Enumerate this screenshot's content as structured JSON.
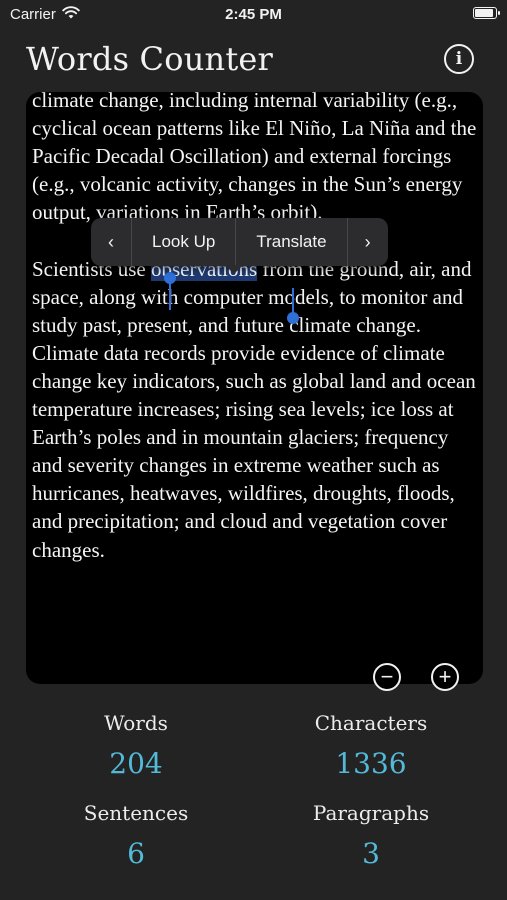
{
  "status_bar": {
    "carrier": "Carrier",
    "time": "2:45 PM",
    "battery_level": 0.9
  },
  "app": {
    "title": "Words Counter",
    "info_icon": "i"
  },
  "editor": {
    "text_before_selection": "climate change, including internal variability (e.g., cyclical ocean patterns like El Niño, La Niña and the Pacific Decadal Oscillation) and external forcings (e.g., volcanic activity, changes in the Sun’s energy output, variations in Earth’s orbit).\n\nScientists use ",
    "selected_text": "observations",
    "text_after_selection": " from the ground, air, and space, along with computer models, to monitor and study past, present, and future climate change. Climate data records provide evidence of climate change key indicators, such as global land and ocean temperature increases; rising sea levels; ice loss at Earth’s poles and in mountain glaciers; frequency and severity changes in extreme weather such as hurricanes, heatwaves, wildfires, droughts, floods, and precipitation; and cloud and vegetation cover changes."
  },
  "context_menu": {
    "prev_icon": "‹",
    "items": [
      "Look Up",
      "Translate"
    ],
    "next_icon": "›"
  },
  "zoom": {
    "out_symbol": "−",
    "in_symbol": "+"
  },
  "stats": {
    "words": {
      "label": "Words",
      "value": "204"
    },
    "characters": {
      "label": "Characters",
      "value": "1336"
    },
    "sentences": {
      "label": "Sentences",
      "value": "6"
    },
    "paragraphs": {
      "label": "Paragraphs",
      "value": "3"
    }
  },
  "colors": {
    "background": "#232323",
    "editor_background": "#000000",
    "stat_value": "#53b9d8",
    "selection_handle": "#2f6fd8"
  },
  "icons": {
    "wifi": "wifi-icon",
    "battery": "battery-icon",
    "info": "info-icon",
    "zoom_out": "minus-circle-icon",
    "zoom_in": "plus-circle-icon"
  }
}
